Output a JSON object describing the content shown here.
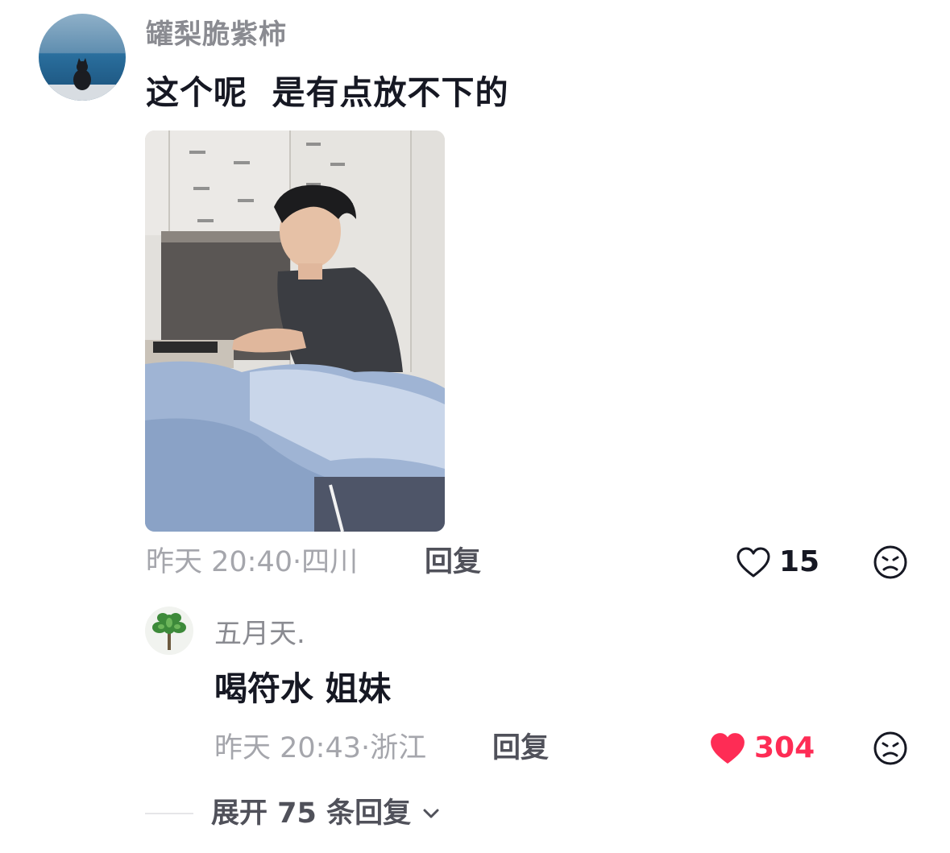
{
  "main_comment": {
    "username": "罐梨脆紫柿",
    "text": "这个呢  是有点放不下的",
    "time_location": "昨天 20:40·四川",
    "reply_label": "回复",
    "likes": "15",
    "liked": false,
    "avatar_icon": "cat-on-seawall-avatar",
    "photo_icon": "photo-man-at-desk"
  },
  "reply_comment": {
    "username": "五月天.",
    "text": "喝符水 姐妹",
    "time_location": "昨天 20:43·浙江",
    "reply_label": "回复",
    "likes": "304",
    "liked": true,
    "avatar_icon": "plant-avatar"
  },
  "expand": {
    "label": "展开 75 条回复"
  },
  "colors": {
    "like_active": "#fe2c55",
    "like_inactive": "#161823",
    "muted_text": "#a5a6ac",
    "username": "#8a8b91"
  },
  "icons": {
    "heart_outline": "heart-outline-icon",
    "heart_filled": "heart-filled-icon",
    "dislike": "dislike-face-icon",
    "chevron": "chevron-down-icon"
  }
}
